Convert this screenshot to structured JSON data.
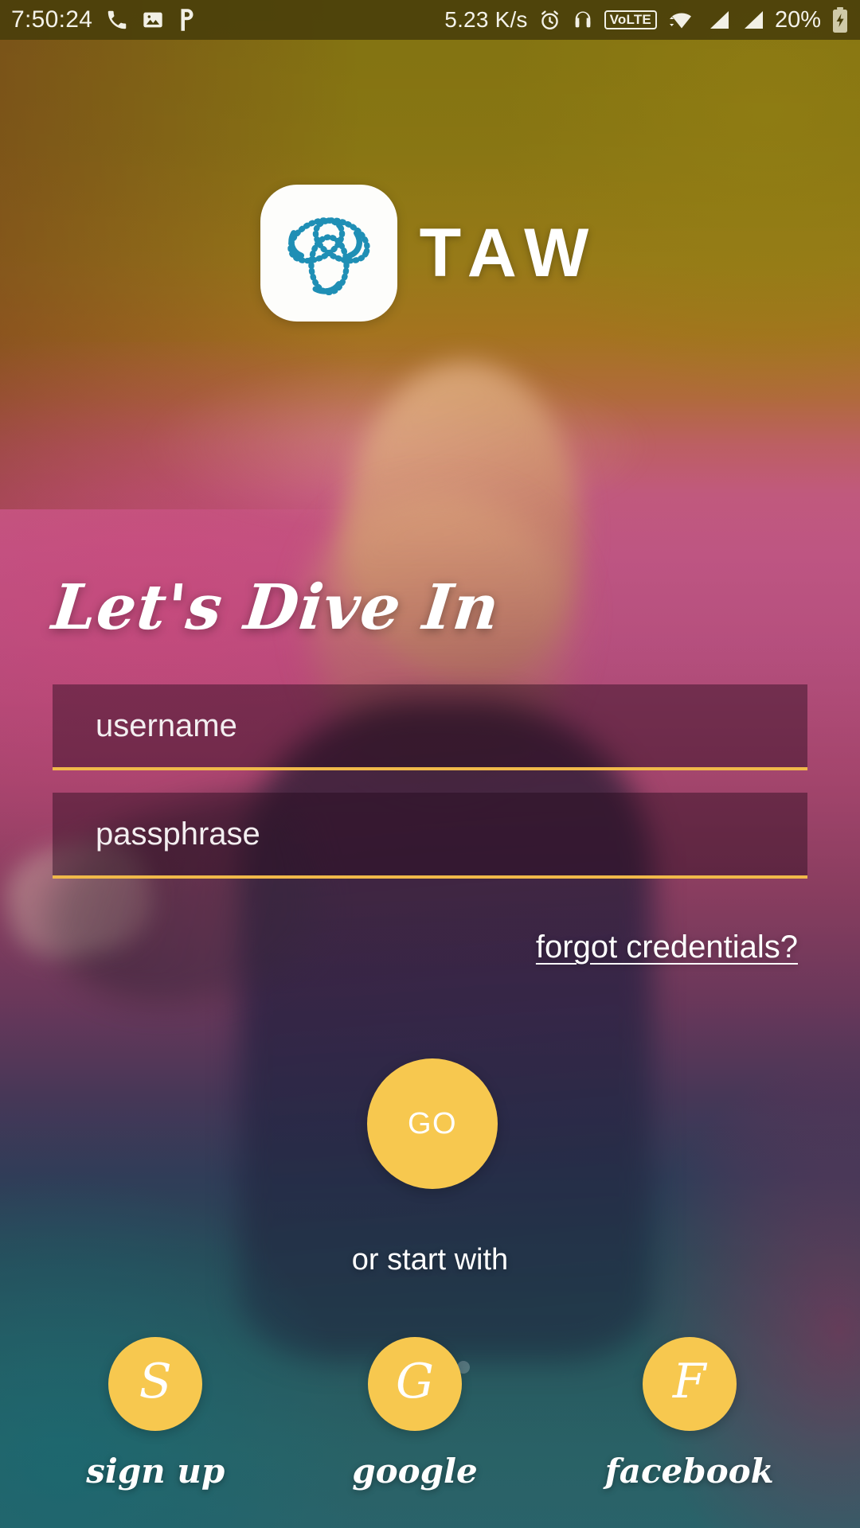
{
  "statusbar": {
    "time": "7:50:24",
    "net_speed": "5.23 K/s",
    "volte_label": "VoLTE",
    "battery_percent": "20%",
    "icons": [
      "phone-icon",
      "gallery-icon",
      "phonepe-icon",
      "alarm-icon",
      "headset-icon",
      "volte-icon",
      "wifi-icon",
      "signal-icon",
      "signal2-icon",
      "battery-charging-icon"
    ],
    "bg_color": "#483E0A",
    "text_color": "#F4F2EA"
  },
  "brand": {
    "name": "TAW",
    "logo_icon": "trefoil-knot-icon",
    "logo_color": "#1F8FB5",
    "tile_color": "#FDFDFB"
  },
  "form": {
    "headline": "Let's Dive In",
    "username": {
      "placeholder": "username",
      "value": ""
    },
    "passphrase": {
      "placeholder": "passphrase",
      "value": ""
    },
    "forgot_label": "forgot credentials?",
    "submit_label": "GO",
    "accent_color": "#F7C84F",
    "underline_color": "#F0B94A",
    "field_bg": "rgba(36,10,28,0.44)"
  },
  "social": {
    "divider_label": "or start with",
    "items": [
      {
        "glyph": "S",
        "label": "sign up",
        "icon": "script-s-icon"
      },
      {
        "glyph": "G",
        "label": "google",
        "icon": "script-g-icon"
      },
      {
        "glyph": "F",
        "label": "facebook",
        "icon": "script-f-icon"
      }
    ]
  },
  "theme": {
    "background_top": "#8A7A12",
    "background_mid": "#C05684",
    "background_bottom": "#2F7078",
    "accent": "#F7C84F",
    "text_on_photo": "#FFFFFF"
  }
}
